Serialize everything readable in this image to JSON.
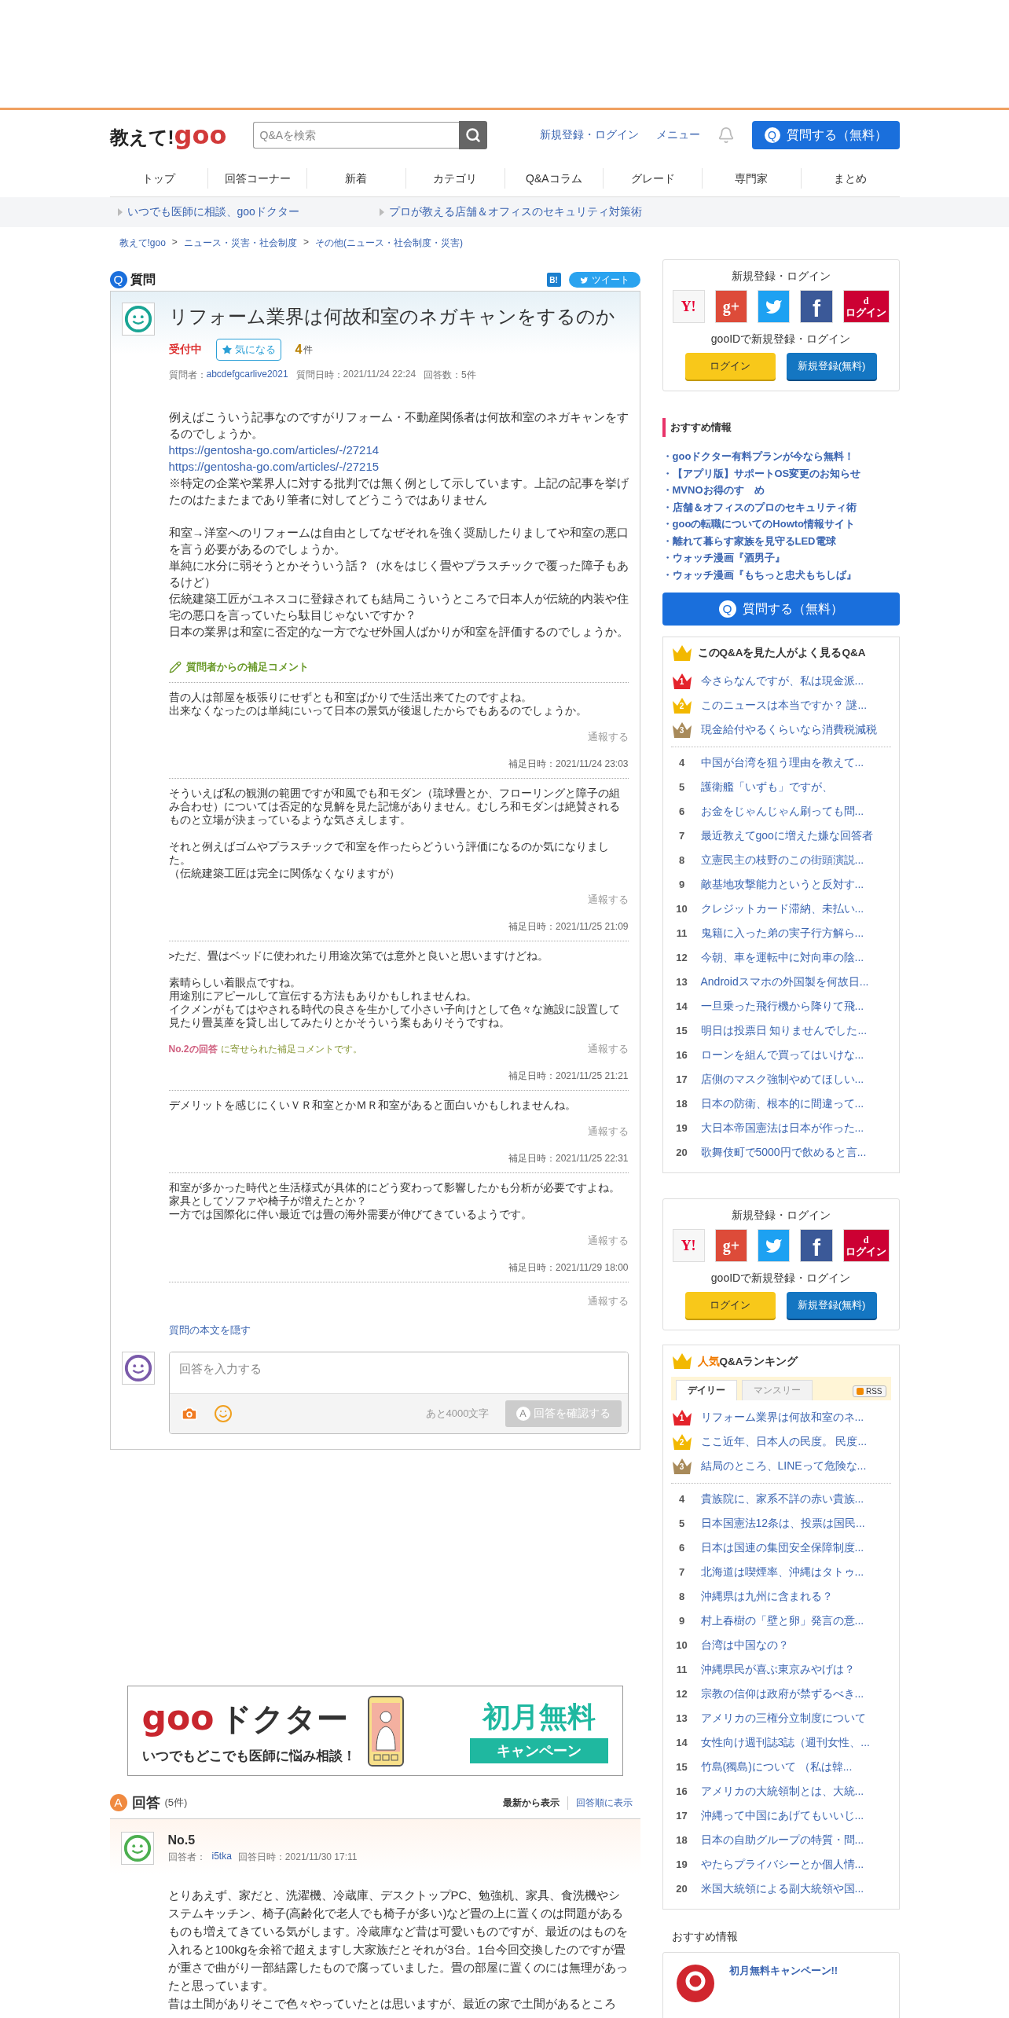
{
  "header": {
    "logo_text": "教えて!",
    "logo_brand": "goo",
    "search": {
      "placeholder": "Q&Aを検索"
    },
    "links": [
      "新規登録・ログイン",
      "メニュー"
    ],
    "ask_button": {
      "icon": "Q",
      "label": "質問する（無料）"
    }
  },
  "nav": [
    "トップ",
    "回答コーナー",
    "新着",
    "カテゴリ",
    "Q&Aコラム",
    "グレード",
    "専門家",
    "まとめ"
  ],
  "promo_links": [
    "いつでも医師に相談、gooドクター",
    "プロが教える店舗＆オフィスのセキュリティ対策術"
  ],
  "breadcrumb": {
    "separator": ">",
    "items": [
      "教えて!goo",
      "ニュース・災害・社会制度",
      "その他(ニュース・社会制度・災害)"
    ]
  },
  "question_section": {
    "icon": "Q",
    "heading": "質問",
    "hatena": "B!",
    "tweet": "ツイート"
  },
  "question": {
    "title": "リフォーム業界は何故和室のネガキャンをするのか",
    "status": "受付中",
    "follow": {
      "label": "気になる",
      "count": "4",
      "unit": "件"
    },
    "meta": [
      {
        "kind": "link",
        "label": "質問者：",
        "value": "abcdefgcarlive2021"
      },
      {
        "kind": "plain",
        "label": "質問日時：",
        "value": "2021/11/24 22:24"
      },
      {
        "kind": "plain",
        "label": "回答数：",
        "value": "5件"
      }
    ],
    "body": [
      [
        {
          "kind": "text",
          "text": "例えばこういう記事なのですがリフォーム・不動産関係者は何故和室のネガキャンをするのでしょうか。"
        },
        {
          "kind": "link",
          "text": "https://gentosha-go.com/articles/-/27214"
        },
        {
          "kind": "link",
          "text": "https://gentosha-go.com/articles/-/27215"
        },
        {
          "kind": "text",
          "text": "※特定の企業や業界人に対する批判では無く例として示しています。上記の記事を挙げたのはたまたまであり筆者に対してどうこうではありません"
        }
      ],
      [
        {
          "kind": "text",
          "text": "和室→洋室へのリフォームは自由としてなぜそれを強く奨励したりましてや和室の悪口を言う必要があるのでしょうか。"
        },
        {
          "kind": "text",
          "text": "単純に水分に弱そうとかそういう話？（水をはじく畳やプラスチックで覆った障子もあるけど）"
        },
        {
          "kind": "text",
          "text": "伝統建築工匠がユネスコに登録されても結局こういうところで日本人が伝統的内装や住宅の悪口を言っていたら駄目じゃないですか？"
        },
        {
          "kind": "text",
          "text": "日本の業界は和室に否定的な一方でなぜ外国人ばかりが和室を評価するのでしょうか。"
        }
      ]
    ],
    "supplement_heading": "質問者からの補足コメント",
    "supplements": [
      {
        "paragraphs": [
          [
            "昔の人は部屋を板張りにせずとも和室ばかりで生活出来てたのですよね。",
            "出来なくなったのは単純にいって日本の景気が後退したからでもあるのでしょうか。"
          ]
        ],
        "report": "通報する",
        "date": "補足日時：2021/11/24 23:03"
      },
      {
        "paragraphs": [
          [
            "そういえば私の観測の範囲ですが和風でも和モダン（琉球畳とか、フローリングと障子の組み合わせ）については否定的な見解を見た記憶がありません。むしろ和モダンは絶賛されるものと立場が決まっているような気さえします。"
          ],
          [
            "それと例えばゴムやプラスチックで和室を作ったらどういう評価になるのか気になりました。",
            "（伝統建築工匠は完全に関係なくなりますが）"
          ]
        ],
        "report": "通報する",
        "date": "補足日時：2021/11/25 21:09"
      },
      {
        "paragraphs": [
          [
            ">ただ、畳はベッドに使われたり用途次第では意外と良いと思いますけどね。"
          ],
          [
            "素晴らしい着眼点ですね。",
            "用途別にアピールして宣伝する方法もありかもしれませんね。",
            "イクメンがもてはやされる時代の良さを生かして小さい子向けとして色々な施設に設置して見たり畳茣蓙を貸し出してみたりとかそういう案もありそうですね。"
          ]
        ],
        "reply_note": {
          "link": "No.2の回答",
          "text": "に寄せられた補足コメントです。"
        },
        "report": "通報する",
        "date": "補足日時：2021/11/25 21:21"
      },
      {
        "paragraphs": [
          [
            "デメリットを感じにくいＶＲ和室とかＭＲ和室があると面白いかもしれませんね。"
          ]
        ],
        "report": "通報する",
        "date": "補足日時：2021/11/25 22:31"
      },
      {
        "paragraphs": [
          [
            "和室が多かった時代と生活様式が具体的にどう変わって影響したかも分析が必要ですよね。",
            "家具としてソファや椅子が増えたとか？",
            "一方では国際化に伴い最近では畳の海外需要が伸びてきているようです。"
          ]
        ],
        "report": "通報する",
        "date": "補足日時：2021/11/29 18:00"
      }
    ],
    "report": "通報する",
    "hide_link": "質問の本文を隠す"
  },
  "answer_form": {
    "placeholder": "回答を入力する",
    "counter": "あと4000文字",
    "submit": {
      "icon": "A",
      "label": "回答を確認する",
      "disabled": true
    }
  },
  "banner": {
    "brand": "goo",
    "title": "ドクター",
    "tagline": "いつでもどこでも医師に悩み相談！",
    "offer": "初月無料",
    "ribbon": "キャンペーン"
  },
  "answers": {
    "icon": "A",
    "heading": "回答",
    "count": "(5件)",
    "sorts": [
      {
        "label": "最新から表示",
        "selected": true
      },
      {
        "label": "回答順に表示",
        "selected": false
      }
    ],
    "items": [
      {
        "number": "No.5",
        "answerer_label": "回答者：",
        "answerer": "i5tka",
        "date": "回答日時：2021/11/30 17:11",
        "body": [
          "とりあえず、家だと、洗濯機、冷蔵庫、デスクトップPC、勉強机、家具、食洗機やシステムキッチン、椅子(高齢化で老人でも椅子が多い)など畳の上に置くのは問題があるものも増えてきている気がします。冷蔵庫など昔は可愛いものですが、最近のはものを入れると100kgを余裕で超えますし大家族だとそれが3台。1台今回交換したのですが畳が重さで曲がり一部結露したもので腐っていました。畳の部屋に置くのには無理があったと思っています。",
          "昔は土間がありそこで色々やっていたとは思いますが、最近の家で土間があるところ"
        ]
      }
    ]
  },
  "sidebar": {
    "login_boxes": [
      {
        "title": "新規登録・ログイン",
        "providers": [
          {
            "kind": "yahoo",
            "label": "Y!"
          },
          {
            "kind": "google",
            "label": "g+"
          },
          {
            "kind": "twitter"
          },
          {
            "kind": "facebook",
            "label": "f"
          },
          {
            "kind": "docomo",
            "mark": "d",
            "label": "ログイン"
          }
        ],
        "subtitle": "gooIDで新規登録・ログイン",
        "login": "ログイン",
        "register": "新規登録(無料)"
      },
      {
        "title": "新規登録・ログイン",
        "providers": [
          {
            "kind": "yahoo",
            "label": "Y!"
          },
          {
            "kind": "google",
            "label": "g+"
          },
          {
            "kind": "twitter"
          },
          {
            "kind": "facebook",
            "label": "f"
          },
          {
            "kind": "docomo",
            "mark": "d",
            "label": "ログイン"
          }
        ],
        "subtitle": "gooIDで新規登録・ログイン",
        "login": "ログイン",
        "register": "新規登録(無料)"
      }
    ],
    "recommend": {
      "heading": "おすすめ情報",
      "items": [
        "・gooドクター有料プランが今なら無料！",
        "・【アプリ版】サポートOS変更のお知らせ",
        "・MVNOお得のす　め",
        "・店舗＆オフィスのプロのセキュリティ術",
        "・gooの転職についてのHowto情報サイト",
        "・離れて暮らす家族を見守るLED電球",
        "・ウォッチ漫画『酒男子』",
        "・ウォッチ漫画『もちっと忠犬もちしば』"
      ]
    },
    "ask_button": {
      "icon": "Q",
      "label": "質問する（無料）"
    },
    "related": {
      "title": "このQ&Aを見た人がよく見るQ&A",
      "items": [
        {
          "rank": "1",
          "text": "今さらなんですが、私は現金派..."
        },
        {
          "rank": "2",
          "text": "このニュースは本当ですか？ 謎..."
        },
        {
          "rank": "3",
          "text": "現金給付やるくらいなら消費税減税"
        },
        {
          "rank": "4",
          "text": "中国が台湾を狙う理由を教えて..."
        },
        {
          "rank": "5",
          "text": "護衛艦「いずも」ですが、"
        },
        {
          "rank": "6",
          "text": "お金をじゃんじゃん刷っても問..."
        },
        {
          "rank": "7",
          "text": "最近教えてgooに増えた嫌な回答者"
        },
        {
          "rank": "8",
          "text": "立憲民主の枝野のこの街頭演説..."
        },
        {
          "rank": "9",
          "text": "敵基地攻撃能力というと反対す..."
        },
        {
          "rank": "10",
          "text": "クレジットカード滞納、未払い..."
        },
        {
          "rank": "11",
          "text": "鬼籍に入った弟の実子行方解ら..."
        },
        {
          "rank": "12",
          "text": "今朝、車を運転中に対向車の陰..."
        },
        {
          "rank": "13",
          "text": "Androidスマホの外国製を何故日..."
        },
        {
          "rank": "14",
          "text": "一旦乗った飛行機から降りて飛..."
        },
        {
          "rank": "15",
          "text": "明日は投票日 知りませんでした..."
        },
        {
          "rank": "16",
          "text": "ローンを組んで買ってはいけな..."
        },
        {
          "rank": "17",
          "text": "店側のマスク強制やめてほしい..."
        },
        {
          "rank": "18",
          "text": "日本の防衛、根本的に間違って..."
        },
        {
          "rank": "19",
          "text": "大日本帝国憲法は日本が作った..."
        },
        {
          "rank": "20",
          "text": "歌舞伎町で5000円で飲めると言..."
        }
      ]
    },
    "popular": {
      "title_highlight": "人気",
      "title": "Q&Aランキング",
      "tabs": [
        {
          "label": "デイリー",
          "selected": true
        },
        {
          "label": "マンスリー",
          "selected": false
        }
      ],
      "rss": "RSS",
      "items": [
        {
          "rank": "1",
          "text": "リフォーム業界は何故和室のネ..."
        },
        {
          "rank": "2",
          "text": "ここ近年、日本人の民度。 民度..."
        },
        {
          "rank": "3",
          "text": "結局のところ、LINEって危険な..."
        },
        {
          "rank": "4",
          "text": "貴族院に、家系不詳の赤い貴族..."
        },
        {
          "rank": "5",
          "text": "日本国憲法12条は、投票は国民..."
        },
        {
          "rank": "6",
          "text": "日本は国連の集団安全保障制度..."
        },
        {
          "rank": "7",
          "text": "北海道は喫煙率、沖縄はタトゥ..."
        },
        {
          "rank": "8",
          "text": "沖縄県は九州に含まれる？"
        },
        {
          "rank": "9",
          "text": "村上春樹の「壁と卵」発言の意..."
        },
        {
          "rank": "10",
          "text": "台湾は中国なの？"
        },
        {
          "rank": "11",
          "text": "沖縄県民が喜ぶ東京みやげは？"
        },
        {
          "rank": "12",
          "text": "宗教の信仰は政府が禁ずるべき..."
        },
        {
          "rank": "13",
          "text": "アメリカの三権分立制度について"
        },
        {
          "rank": "14",
          "text": "女性向け週刊誌3誌（週刊女性、..."
        },
        {
          "rank": "15",
          "text": "竹島(獨島)について （私は韓..."
        },
        {
          "rank": "16",
          "text": "アメリカの大統領制とは、大統..."
        },
        {
          "rank": "17",
          "text": "沖縄って中国にあげてもいいじ..."
        },
        {
          "rank": "18",
          "text": "日本の自助グループの特質・問..."
        },
        {
          "rank": "19",
          "text": "やたらプライバシーとか個人情..."
        },
        {
          "rank": "20",
          "text": "米国大統領による副大統領や国..."
        }
      ]
    },
    "recommend2": {
      "heading": "おすすめ情報",
      "card": {
        "title": "初月無料キャンペーン!!"
      }
    }
  }
}
